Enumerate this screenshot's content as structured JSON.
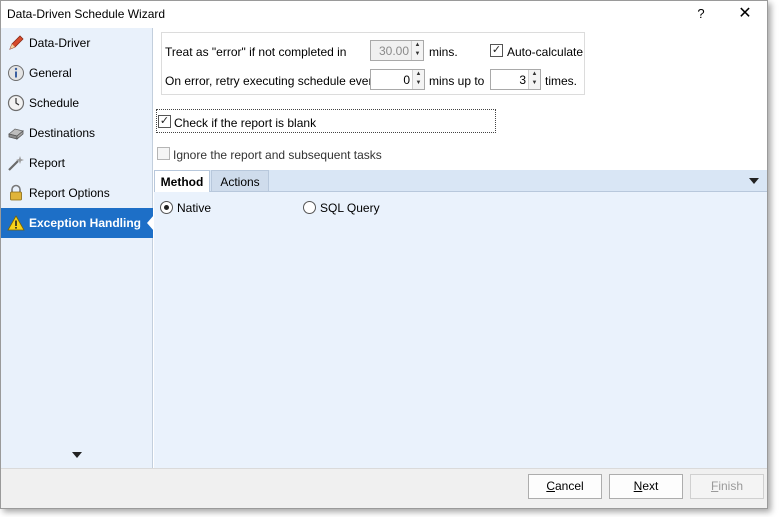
{
  "window": {
    "title": "Data-Driven Schedule Wizard",
    "help_label": "?",
    "close_label": "✕"
  },
  "sidebar": {
    "items": [
      {
        "label": "Data-Driver",
        "icon": "pencil-icon",
        "active": false
      },
      {
        "label": "General",
        "icon": "info-icon",
        "active": false
      },
      {
        "label": "Schedule",
        "icon": "clock-icon",
        "active": false
      },
      {
        "label": "Destinations",
        "icon": "drive-icon",
        "active": false
      },
      {
        "label": "Report",
        "icon": "wand-icon",
        "active": false
      },
      {
        "label": "Report Options",
        "icon": "lock-icon",
        "active": false
      },
      {
        "label": "Exception Handling",
        "icon": "warning-icon",
        "active": true
      }
    ],
    "accent_color": "#1d6fc7"
  },
  "timeout": {
    "treat_label": "Treat as \"error\" if not completed in",
    "minutes_value": "30.00",
    "mins_label": "mins.",
    "auto_calculate_label": "Auto-calculate",
    "auto_calculate_checked": true,
    "retry_label": "On error, retry  executing schedule every",
    "retry_every_value": "0",
    "mins_up_to_label": "mins up to",
    "retry_times_value": "3",
    "times_label": "times."
  },
  "blank_check": {
    "label": "Check if the report is blank",
    "checked": true
  },
  "ignore_check": {
    "label": "Ignore the report and subsequent tasks",
    "checked": false
  },
  "tabs": {
    "items": [
      {
        "label": "Method",
        "active": true
      },
      {
        "label": "Actions",
        "active": false
      }
    ]
  },
  "method": {
    "native_label": "Native",
    "sql_label": "SQL Query",
    "selected": "Native"
  },
  "footer": {
    "cancel_prefix": "",
    "cancel_underline": "C",
    "cancel_rest": "ancel",
    "next_prefix": "",
    "next_underline": "N",
    "next_rest": "ext",
    "finish_prefix": "",
    "finish_underline": "F",
    "finish_rest": "inish"
  }
}
